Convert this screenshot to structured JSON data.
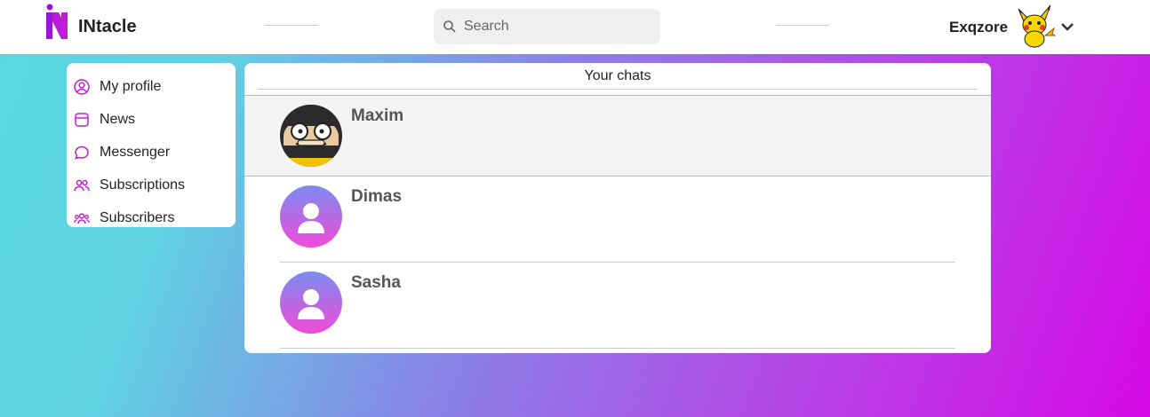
{
  "header": {
    "brand": "INtacle",
    "search_placeholder": "Search",
    "username": "Exqzore"
  },
  "sidebar": {
    "items": [
      {
        "label": "My profile",
        "icon": "user-circle-icon"
      },
      {
        "label": "News",
        "icon": "news-icon"
      },
      {
        "label": "Messenger",
        "icon": "message-icon"
      },
      {
        "label": "Subscriptions",
        "icon": "users-icon"
      },
      {
        "label": "Subscribers",
        "icon": "group-icon"
      }
    ]
  },
  "chats": {
    "title": "Your chats",
    "items": [
      {
        "name": "Maxim"
      },
      {
        "name": "Dimas"
      },
      {
        "name": "Sasha"
      }
    ]
  },
  "colors": {
    "accent": "#c21bd6",
    "gradient_start": "#5ad6e2",
    "gradient_end": "#d60ae6"
  }
}
